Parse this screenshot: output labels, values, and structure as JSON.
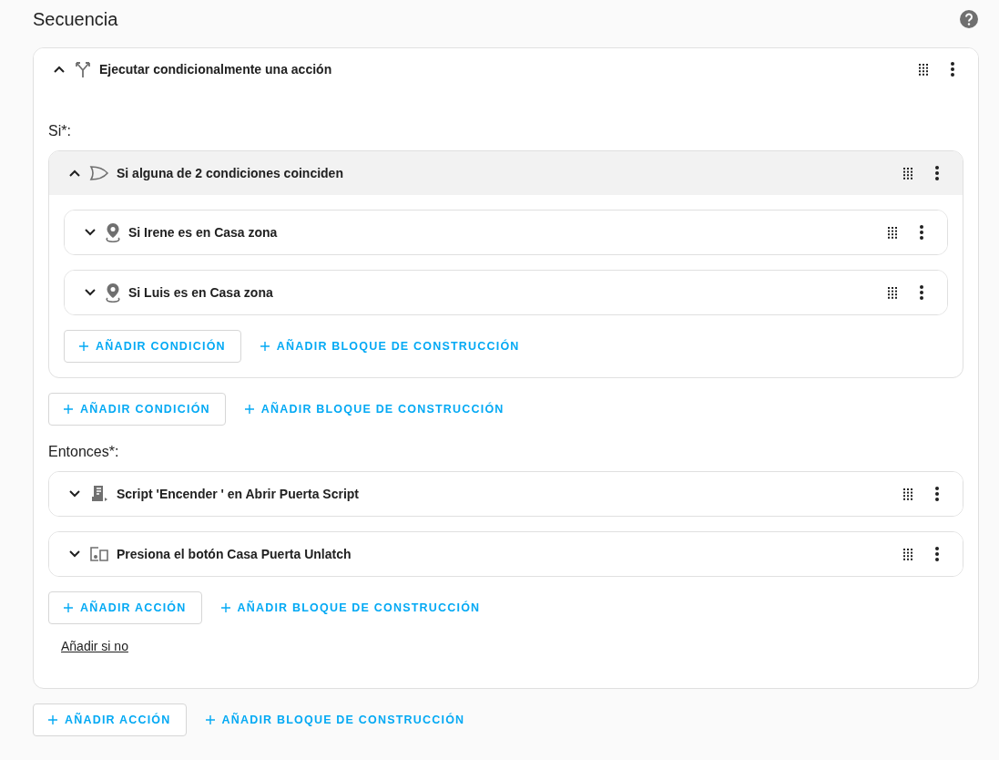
{
  "title": "Secuencia",
  "items": [
    {
      "kind": "branch",
      "title": "Ejecutar condicionalmente una acción",
      "expanded": true,
      "shaded": false,
      "sections": [
        {
          "label": "Si*:",
          "items": [
            {
              "kind": "or",
              "title": "Si alguna de 2 condiciones coinciden",
              "expanded": true,
              "shaded": true,
              "sections": [
                {
                  "items": [
                    {
                      "kind": "marker",
                      "title": "Si Irene es en Casa zona",
                      "expanded": false,
                      "shaded": false
                    },
                    {
                      "kind": "marker",
                      "title": "Si Luis es en Casa zona",
                      "expanded": false,
                      "shaded": false
                    }
                  ],
                  "buttons": [
                    {
                      "label": "AÑADIR CONDICIÓN",
                      "outlined": true
                    },
                    {
                      "label": "AÑADIR BLOQUE DE CONSTRUCCIÓN",
                      "outlined": false
                    }
                  ]
                }
              ]
            }
          ],
          "buttons": [
            {
              "label": "AÑADIR CONDICIÓN",
              "outlined": true
            },
            {
              "label": "AÑADIR BLOQUE DE CONSTRUCCIÓN",
              "outlined": false
            }
          ]
        },
        {
          "label": "Entonces*:",
          "items": [
            {
              "kind": "script",
              "title": "Script 'Encender ' en Abrir Puerta Script",
              "expanded": false,
              "shaded": false
            },
            {
              "kind": "button",
              "title": "Presiona el botón Casa Puerta Unlatch",
              "expanded": false,
              "shaded": false
            }
          ],
          "buttons": [
            {
              "label": "AÑADIR ACCIÓN",
              "outlined": true
            },
            {
              "label": "AÑADIR BLOQUE DE CONSTRUCCIÓN",
              "outlined": false
            }
          ],
          "link": "Añadir si no"
        }
      ]
    }
  ],
  "buttons": [
    {
      "label": "AÑADIR ACCIÓN",
      "outlined": true
    },
    {
      "label": "AÑADIR BLOQUE DE CONSTRUCCIÓN",
      "outlined": false
    }
  ]
}
